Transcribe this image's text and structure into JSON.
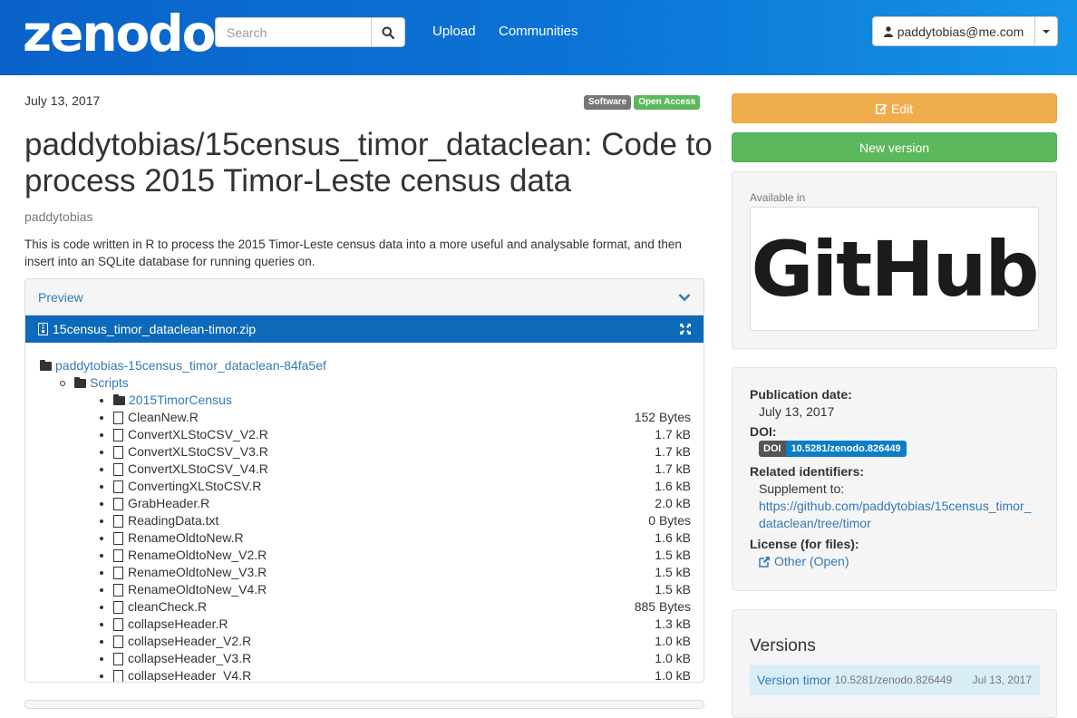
{
  "header": {
    "logo": "zenodo",
    "search_placeholder": "Search",
    "nav": [
      "Upload",
      "Communities"
    ],
    "user": "paddytobias@me.com"
  },
  "record": {
    "date": "July 13, 2017",
    "badges": [
      "Software",
      "Open Access"
    ],
    "title": "paddytobias/15census_timor_dataclean: Code to process 2015 Timor-Leste census data",
    "creator": "paddytobias",
    "description": "This is code written in R to process the 2015 Timor-Leste census data into a more useful and analysable format, and then insert into an SQLite database for running queries on."
  },
  "preview": {
    "label": "Preview",
    "file": "15census_timor_dataclean-timor.zip",
    "root_folder": "paddytobias-15census_timor_dataclean-84fa5ef",
    "sub_folder": "Scripts",
    "items": [
      {
        "name": "2015TimorCensus",
        "type": "folder",
        "size": ""
      },
      {
        "name": "CleanNew.R",
        "type": "file",
        "size": "152 Bytes"
      },
      {
        "name": "ConvertXLStoCSV_V2.R",
        "type": "file",
        "size": "1.7 kB"
      },
      {
        "name": "ConvertXLStoCSV_V3.R",
        "type": "file",
        "size": "1.7 kB"
      },
      {
        "name": "ConvertXLStoCSV_V4.R",
        "type": "file",
        "size": "1.7 kB"
      },
      {
        "name": "ConvertingXLStoCSV.R",
        "type": "file",
        "size": "1.6 kB"
      },
      {
        "name": "GrabHeader.R",
        "type": "file",
        "size": "2.0 kB"
      },
      {
        "name": "ReadingData.txt",
        "type": "file",
        "size": "0 Bytes"
      },
      {
        "name": "RenameOldtoNew.R",
        "type": "file",
        "size": "1.6 kB"
      },
      {
        "name": "RenameOldtoNew_V2.R",
        "type": "file",
        "size": "1.5 kB"
      },
      {
        "name": "RenameOldtoNew_V3.R",
        "type": "file",
        "size": "1.5 kB"
      },
      {
        "name": "RenameOldtoNew_V4.R",
        "type": "file",
        "size": "1.5 kB"
      },
      {
        "name": "cleanCheck.R",
        "type": "file",
        "size": "885 Bytes"
      },
      {
        "name": "collapseHeader.R",
        "type": "file",
        "size": "1.3 kB"
      },
      {
        "name": "collapseHeader_V2.R",
        "type": "file",
        "size": "1.0 kB"
      },
      {
        "name": "collapseHeader_V3.R",
        "type": "file",
        "size": "1.0 kB"
      },
      {
        "name": "collapseHeader_V4.R",
        "type": "file",
        "size": "1.0 kB"
      }
    ]
  },
  "sidebar": {
    "edit_label": "Edit",
    "new_version_label": "New version",
    "available_in": "Available in",
    "github_text": "GitHub",
    "pub_date_label": "Publication date:",
    "pub_date": "July 13, 2017",
    "doi_label": "DOI:",
    "doi_tag": "DOI",
    "doi_value": "10.5281/zenodo.826449",
    "related_label": "Related identifiers:",
    "supplement_label": "Supplement to:",
    "related_link_1": "https://github.com/paddytobias/15census_timor_",
    "related_link_2": "dataclean/tree/timor",
    "license_label": "License (for files):",
    "license_value": "Other (Open)",
    "versions_title": "Versions",
    "version_name": "Version timor",
    "version_doi": "10.5281/zenodo.826449",
    "version_date": "Jul 13, 2017"
  },
  "colors": {
    "header_blue": "#0c74d6",
    "file_bar": "#0c6ab8",
    "edit": "#f0ad4e",
    "new_version": "#5cb85c",
    "link": "#337ab7"
  }
}
